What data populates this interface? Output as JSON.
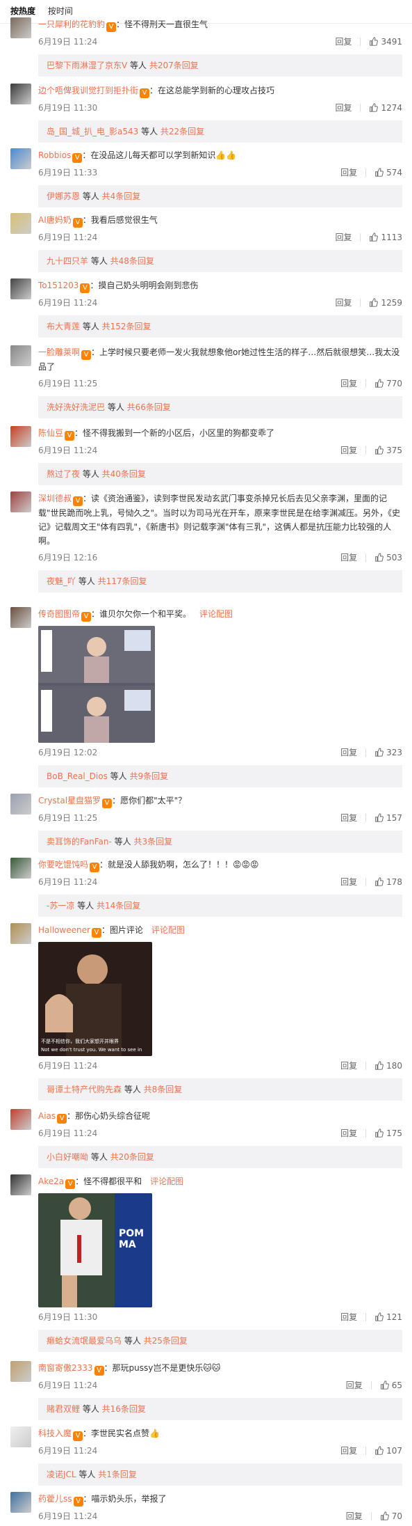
{
  "tabs": {
    "hot": "按热度",
    "time": "按时间"
  },
  "actions": {
    "reply": "回复",
    "view_pic": "评论配图"
  },
  "comments": [
    {
      "user": "一只犀利的花豹豹",
      "text": "：怪不得刑天一直很生气",
      "time": "6月19日 11:24",
      "likes": "3491",
      "sub": {
        "name": "巴黎下雨淋湿了京东V",
        "text": " 等人 ",
        "more": "共207条回复"
      }
    },
    {
      "user": "边个唔俾我训觉打到拒扑街",
      "text": "：在这总能学到新的心理攻占技巧",
      "time": "6月19日 11:30",
      "likes": "1274",
      "sub": {
        "name": "岛_国_城_扒_电_影a543",
        "text": " 等人 ",
        "more": "共22条回复"
      }
    },
    {
      "user": "Robbios",
      "text": "：在没品这儿每天都可以学到新知识👍👍",
      "time": "6月19日 11:33",
      "likes": "574",
      "sub": {
        "name": "伊娜苏恩",
        "text": " 等人 ",
        "more": "共4条回复"
      }
    },
    {
      "user": "AI唐妈奶",
      "text": "：我看后感觉很生气",
      "time": "6月19日 11:24",
      "likes": "1113",
      "sub": {
        "name": "九十四只羊",
        "text": " 等人 ",
        "more": "共48条回复"
      }
    },
    {
      "user": "To151203",
      "text": "：摸自己奶头明明会刚到悲伤",
      "time": "6月19日 11:24",
      "likes": "1259",
      "sub": {
        "name": "布大青莲",
        "text": " 等人 ",
        "more": "共152条回复"
      }
    },
    {
      "user": "一脸雕莱啊",
      "text": "：上学时候只要老师一发火我就想象他or她过性生活的样子…然后就很想笑…我太没品了",
      "time": "6月19日 11:25",
      "likes": "770",
      "sub": {
        "name": "洗好洗好洗泥巴",
        "text": " 等人 ",
        "more": "共66条回复"
      }
    },
    {
      "user": "陈仙豆",
      "text": "：怪不得我搬到一个新的小区后，小区里的狗都变乖了",
      "time": "6月19日 11:24",
      "likes": "375",
      "sub": {
        "name": "熬过了夜",
        "text": " 等人 ",
        "more": "共40条回复"
      }
    },
    {
      "user": "深圳德叔",
      "text": "：读《资治通鉴》，读到李世民发动玄武门事变杀掉兄长后去见父亲李渊，里面的记载\"世民跪而吮上乳，号恸久之\"。当时以为司马光在开车，原来李世民是在给李渊减压。另外，《史记》记载周文王\"体有四乳\"，《新唐书》则记载李渊\"体有三乳\"，这俩人都是抗压能力比较强的人啊。",
      "time": "6月19日 12:16",
      "likes": "503",
      "sub": {
        "name": "夜魅_吖",
        "text": " 等人 ",
        "more": "共117条回复"
      }
    },
    {
      "user": "传奇图图帝",
      "text": "：谁贝尔欠你一个和平奖。",
      "time": "6月19日 12:02",
      "likes": "323",
      "sub": {
        "name": "BoB_Real_Dios",
        "text": " 等人 ",
        "more": "共9条回复"
      }
    },
    {
      "user": "Crystal星盘猫罗",
      "text": "：愿你们都\"太平\"？",
      "time": "6月19日 11:25",
      "likes": "157",
      "sub": {
        "name": "卖耳饰的FanFan-",
        "text": " 等人 ",
        "more": "共3条回复"
      }
    },
    {
      "user": "你要吃馄饨吗",
      "text": "：就是没人舔我奶啊，怎么了！！！😡😡😡",
      "time": "6月19日 11:24",
      "likes": "178",
      "sub": {
        "name": "-苏一凉",
        "text": " 等人 ",
        "more": "共14条回复"
      }
    },
    {
      "user": "Halloweener",
      "text": "：图片评论",
      "time": "6月19日 11:24",
      "likes": "180",
      "sub": {
        "name": "哥谭土特产代购先森",
        "text": " 等人 ",
        "more": "共8条回复"
      }
    },
    {
      "user": "Aias",
      "text": "：那伤心奶头综合征呢",
      "time": "6月19日 11:24",
      "likes": "175",
      "sub": {
        "name": "小白好嘲呦",
        "text": " 等人 ",
        "more": "共20条回复"
      }
    },
    {
      "user": "Ake2a",
      "text": "：怪不得都很平和",
      "time": "6月19日 11:30",
      "likes": "121",
      "sub": {
        "name": "癞蛤女流氓最爱乌乌",
        "text": " 等人 ",
        "more": "共25条回复"
      }
    },
    {
      "user": "南窗寄傲2333",
      "text": "：那玩pussy岂不是更快乐🐱🐱",
      "time": "6月19日 11:24",
      "likes": "65",
      "sub": {
        "name": "赌君双鲤",
        "text": " 等人 ",
        "more": "共16条回复"
      }
    },
    {
      "user": "科技入魔",
      "text": "：李世民实名点赞👍",
      "time": "6月19日 11:24",
      "likes": "107",
      "sub": {
        "name": "凌诺JCL",
        "text": " 等人 ",
        "more": "共1条回复"
      }
    },
    {
      "user": "药藿儿ss",
      "text": "：喵示奶头乐，举报了",
      "time": "6月19日 11:24",
      "likes": "70",
      "sub": null
    }
  ],
  "pic_captions": {
    "c11_top": "不是不相信你，我们大家想开并眼界",
    "c11_bottom": "Not we don't trust you. We want to see in",
    "c13_text": "POM MA"
  },
  "colors": {
    "link": "#eb7350",
    "subbg": "#f2f2f5",
    "time": "#808080"
  }
}
